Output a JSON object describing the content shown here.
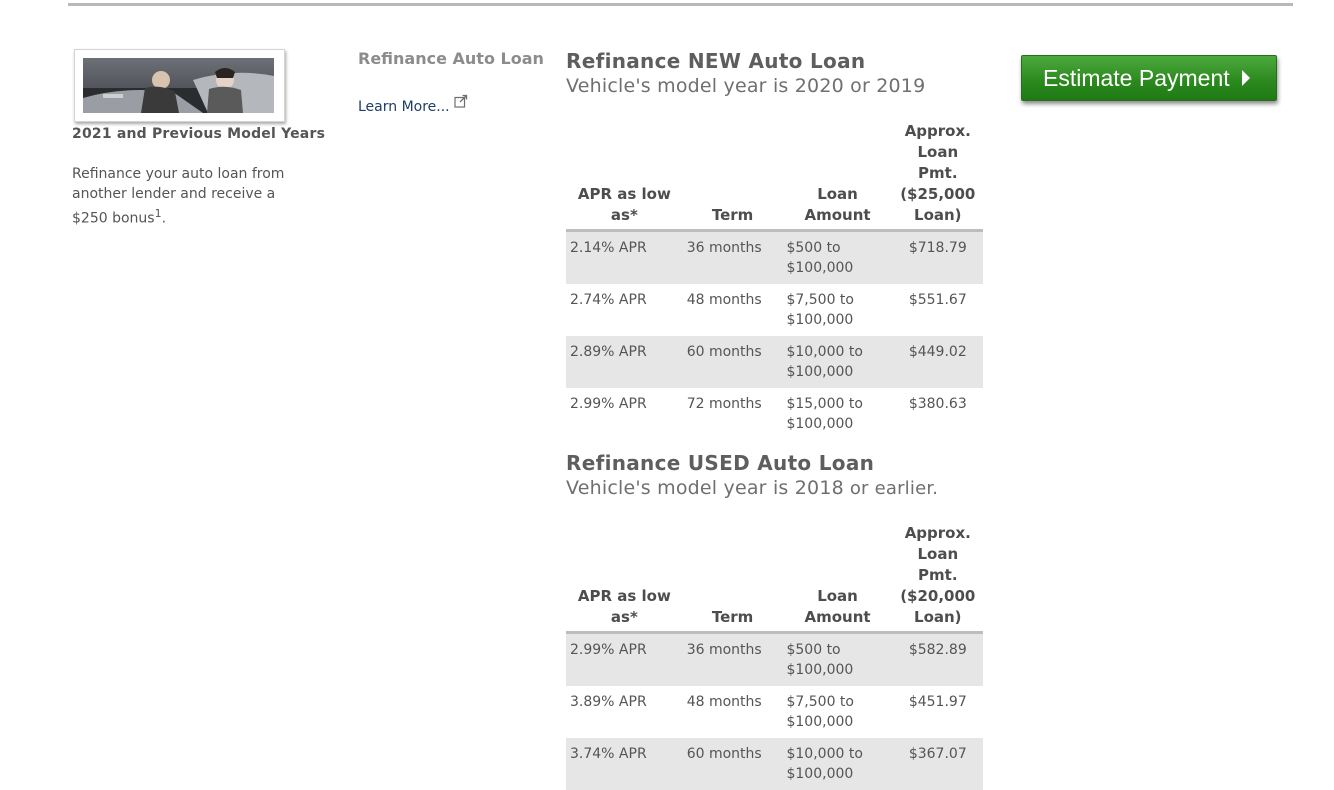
{
  "promo": {
    "model_years": "2021 and Previous Model Years",
    "text": "Refinance your auto loan from another lender and receive a $250 bonus",
    "footnote": "1",
    "trailing": "."
  },
  "product": {
    "name": "Refinance Auto Loan",
    "learn_more": "Learn More..."
  },
  "estimate_button": "Estimate Payment",
  "new_loan": {
    "title": "Refinance NEW Auto Loan",
    "subtitle": "Vehicle's model year is 2020 or 2019",
    "headers": [
      "APR as low as*",
      "Term",
      "Loan Amount",
      "Approx. Loan Pmt. ($25,000 Loan)"
    ],
    "rows": [
      [
        "2.14% APR",
        "36 months",
        "$500 to $100,000",
        "$718.79"
      ],
      [
        "2.74% APR",
        "48 months",
        "$7,500 to $100,000",
        "$551.67"
      ],
      [
        "2.89% APR",
        "60 months",
        "$10,000 to $100,000",
        "$449.02"
      ],
      [
        "2.99% APR",
        "72 months",
        "$15,000 to $100,000",
        "$380.63"
      ]
    ]
  },
  "used_loan": {
    "title": "Refinance USED Auto Loan",
    "subtitle": "Vehicle's model year is 2018",
    "subtitle_tail": " or earlier.",
    "headers": [
      "APR as low as*",
      "Term",
      "Loan Amount",
      "Approx. Loan Pmt. ($20,000 Loan)"
    ],
    "rows": [
      [
        "2.99% APR",
        "36 months",
        "$500 to $100,000",
        "$582.89"
      ],
      [
        "3.89% APR",
        "48 months",
        "$7,500 to $100,000",
        "$451.97"
      ],
      [
        "3.74% APR",
        "60 months",
        "$10,000 to $100,000",
        "$367.07"
      ]
    ]
  }
}
